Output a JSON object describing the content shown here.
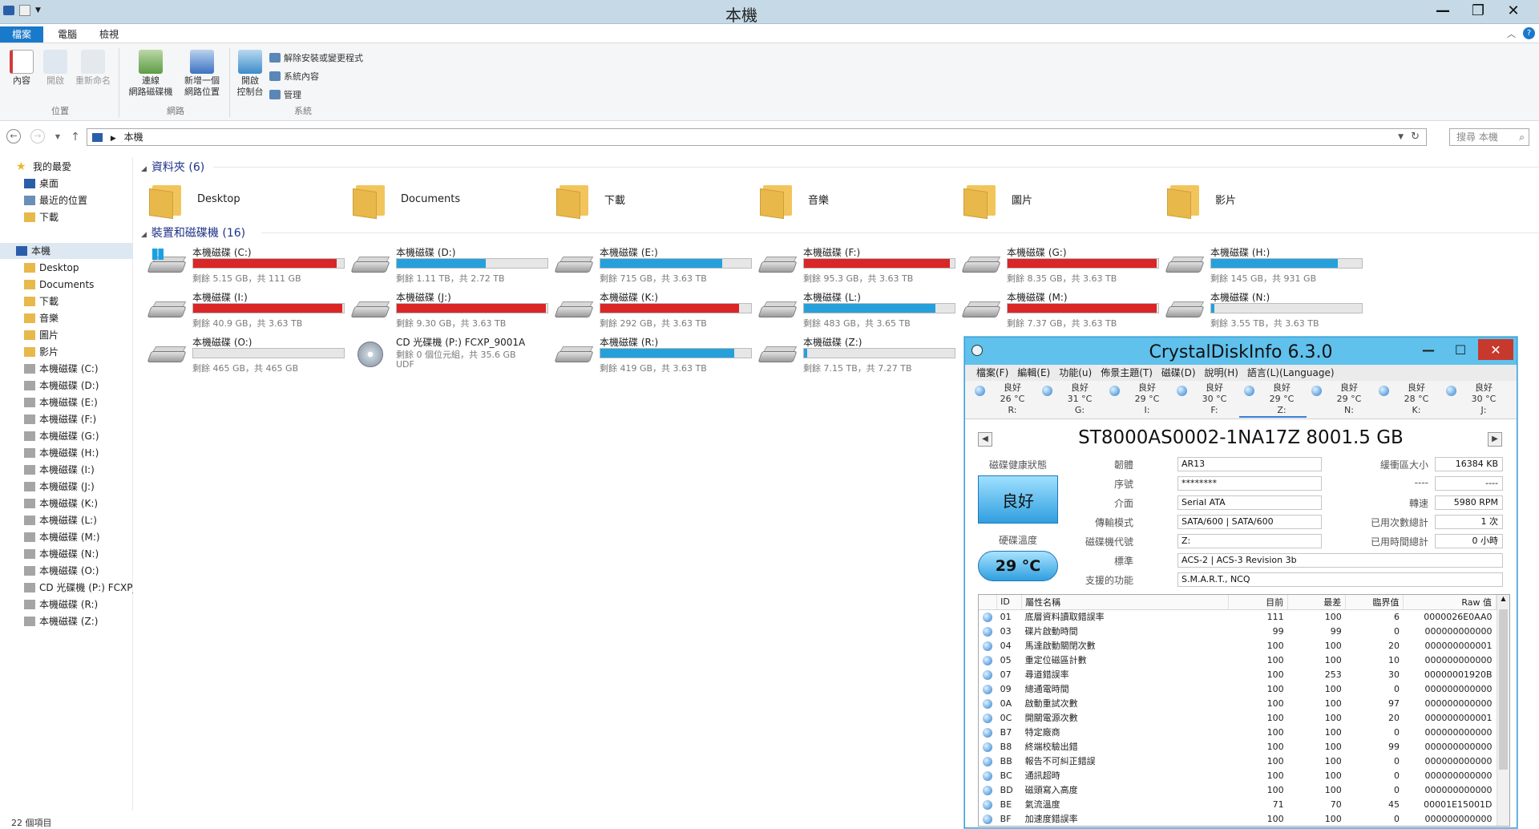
{
  "window": {
    "title": "本機"
  },
  "ribbon_tabs": [
    "檔案",
    "電腦",
    "檢視"
  ],
  "ribbon": {
    "location_group": "位置",
    "network_group": "網路",
    "system_group": "系統",
    "buttons": {
      "properties": "內容",
      "open": "開啟",
      "rename": "重新命名",
      "map_drive_1": "連線",
      "map_drive_2": "網路磁碟機",
      "add_location_1": "新增一個",
      "add_location_2": "網路位置",
      "control_panel_1": "開啟",
      "control_panel_2": "控制台",
      "uninstall": "解除安裝或變更程式",
      "sys_props": "系統內容",
      "manage": "管理"
    }
  },
  "address": {
    "path": "本機",
    "search_placeholder": "搜尋 本機"
  },
  "navpane": {
    "favorites": "我的最愛",
    "fav_items": [
      "桌面",
      "最近的位置",
      "下載"
    ],
    "thispc": "本機",
    "pc_items": [
      "Desktop",
      "Documents",
      "下載",
      "音樂",
      "圖片",
      "影片",
      "本機磁碟 (C:)",
      "本機磁碟 (D:)",
      "本機磁碟 (E:)",
      "本機磁碟 (F:)",
      "本機磁碟 (G:)",
      "本機磁碟 (H:)",
      "本機磁碟 (I:)",
      "本機磁碟 (J:)",
      "本機磁碟 (K:)",
      "本機磁碟 (L:)",
      "本機磁碟 (M:)",
      "本機磁碟 (N:)",
      "本機磁碟 (O:)",
      "CD 光碟機 (P:) FCXP_",
      "本機磁碟 (R:)",
      "本機磁碟 (Z:)"
    ]
  },
  "content": {
    "folders_header": "資料夾 (6)",
    "folders": [
      "Desktop",
      "Documents",
      "下載",
      "音樂",
      "圖片",
      "影片"
    ],
    "drives_header": "裝置和磁碟機 (16)",
    "drives": [
      {
        "name": "本機磁碟 (C:)",
        "free": "剩餘 5.15 GB，共 111 GB",
        "used": 0.95,
        "color": "#da2626"
      },
      {
        "name": "本機磁碟 (D:)",
        "free": "剩餘 1.11 TB，共 2.72 TB",
        "used": 0.59,
        "color": "#26a0da"
      },
      {
        "name": "本機磁碟 (E:)",
        "free": "剩餘 715 GB，共 3.63 TB",
        "used": 0.81,
        "color": "#26a0da"
      },
      {
        "name": "本機磁碟 (F:)",
        "free": "剩餘 95.3 GB，共 3.63 TB",
        "used": 0.97,
        "color": "#da2626"
      },
      {
        "name": "本機磁碟 (G:)",
        "free": "剩餘 8.35 GB，共 3.63 TB",
        "used": 0.99,
        "color": "#da2626"
      },
      {
        "name": "本機磁碟 (H:)",
        "free": "剩餘 145 GB，共 931 GB",
        "used": 0.84,
        "color": "#26a0da"
      },
      {
        "name": "本機磁碟 (I:)",
        "free": "剩餘 40.9 GB，共 3.63 TB",
        "used": 0.99,
        "color": "#da2626"
      },
      {
        "name": "本機磁碟 (J:)",
        "free": "剩餘 9.30 GB，共 3.63 TB",
        "used": 0.99,
        "color": "#da2626"
      },
      {
        "name": "本機磁碟 (K:)",
        "free": "剩餘 292 GB，共 3.63 TB",
        "used": 0.92,
        "color": "#da2626"
      },
      {
        "name": "本機磁碟 (L:)",
        "free": "剩餘 483 GB，共 3.65 TB",
        "used": 0.87,
        "color": "#26a0da"
      },
      {
        "name": "本機磁碟 (M:)",
        "free": "剩餘 7.37 GB，共 3.63 TB",
        "used": 0.99,
        "color": "#da2626"
      },
      {
        "name": "本機磁碟 (N:)",
        "free": "剩餘 3.55 TB，共 3.63 TB",
        "used": 0.02,
        "color": "#26a0da"
      },
      {
        "name": "本機磁碟 (O:)",
        "free": "剩餘 465 GB，共 465 GB",
        "used": 0.0,
        "color": "#26a0da"
      },
      {
        "name": "CD 光碟機 (P:) FCXP_9001A",
        "free": "剩餘 0 個位元組，共 35.6 GB",
        "extra": "UDF",
        "cd": true
      },
      {
        "name": "本機磁碟 (R:)",
        "free": "剩餘 419 GB，共 3.63 TB",
        "used": 0.89,
        "color": "#26a0da"
      },
      {
        "name": "本機磁碟 (Z:)",
        "free": "剩餘 7.15 TB，共 7.27 TB",
        "used": 0.02,
        "color": "#26a0da"
      }
    ]
  },
  "statusbar": "22 個項目",
  "cdi": {
    "title": "CrystalDiskInfo 6.3.0",
    "menu": [
      "檔案(F)",
      "編輯(E)",
      "功能(u)",
      "佈景主題(T)",
      "磁碟(D)",
      "說明(H)",
      "語言(L)(Language)"
    ],
    "disks": [
      {
        "status": "良好",
        "temp": "26 °C",
        "letter": "R:"
      },
      {
        "status": "良好",
        "temp": "31 °C",
        "letter": "G:"
      },
      {
        "status": "良好",
        "temp": "29 °C",
        "letter": "I:"
      },
      {
        "status": "良好",
        "temp": "30 °C",
        "letter": "F:"
      },
      {
        "status": "良好",
        "temp": "29 °C",
        "letter": "Z:"
      },
      {
        "status": "良好",
        "temp": "29 °C",
        "letter": "N:"
      },
      {
        "status": "良好",
        "temp": "28 °C",
        "letter": "K:"
      },
      {
        "status": "良好",
        "temp": "30 °C",
        "letter": "J:"
      }
    ],
    "model": "ST8000AS0002-1NA17Z 8001.5 GB",
    "health_label": "磁碟健康狀態",
    "health_value": "良好",
    "temp_label": "硬碟溫度",
    "temp_value": "29 °C",
    "fields": {
      "firmware_label": "韌體",
      "firmware": "AR13",
      "serial_label": "序號",
      "serial": "********",
      "interface_label": "介面",
      "interface": "Serial ATA",
      "transfer_label": "傳輸模式",
      "transfer": "SATA/600 | SATA/600",
      "driveletter_label": "磁碟機代號",
      "driveletter": "Z:",
      "standard_label": "標準",
      "standard": "ACS-2 | ACS-3 Revision 3b",
      "features_label": "支援的功能",
      "features": "S.M.A.R.T., NCQ",
      "buffer_label": "緩衝區大小",
      "buffer": "16384 KB",
      "dash1_label": "----",
      "dash1": "----",
      "rotation_label": "轉速",
      "rotation": "5980 RPM",
      "poweron_count_label": "已用次數總計",
      "poweron_count": "1 次",
      "poweron_hours_label": "已用時間總計",
      "poweron_hours": "0 小時"
    },
    "smart_headers": [
      "ID",
      "屬性名稱",
      "目前",
      "最差",
      "臨界值",
      "Raw 值"
    ],
    "smart_rows": [
      [
        "01",
        "底層資料讀取錯誤率",
        "111",
        "100",
        "6",
        "0000026E0AA0"
      ],
      [
        "03",
        "碟片啟動時間",
        "99",
        "99",
        "0",
        "000000000000"
      ],
      [
        "04",
        "馬達啟動關閉次數",
        "100",
        "100",
        "20",
        "000000000001"
      ],
      [
        "05",
        "重定位磁區計數",
        "100",
        "100",
        "10",
        "000000000000"
      ],
      [
        "07",
        "尋道錯誤率",
        "100",
        "253",
        "30",
        "00000001920B"
      ],
      [
        "09",
        "總通電時間",
        "100",
        "100",
        "0",
        "000000000000"
      ],
      [
        "0A",
        "啟動重試次數",
        "100",
        "100",
        "97",
        "000000000000"
      ],
      [
        "0C",
        "開關電源次數",
        "100",
        "100",
        "20",
        "000000000001"
      ],
      [
        "B7",
        "特定廠商",
        "100",
        "100",
        "0",
        "000000000000"
      ],
      [
        "B8",
        "終端校驗出錯",
        "100",
        "100",
        "99",
        "000000000000"
      ],
      [
        "BB",
        "報告不可糾正錯誤",
        "100",
        "100",
        "0",
        "000000000000"
      ],
      [
        "BC",
        "通訊超時",
        "100",
        "100",
        "0",
        "000000000000"
      ],
      [
        "BD",
        "磁頭寫入高度",
        "100",
        "100",
        "0",
        "000000000000"
      ],
      [
        "BE",
        "氣流溫度",
        "71",
        "70",
        "45",
        "00001E15001D"
      ],
      [
        "BF",
        "加速度錯誤率",
        "100",
        "100",
        "0",
        "000000000000"
      ]
    ]
  }
}
